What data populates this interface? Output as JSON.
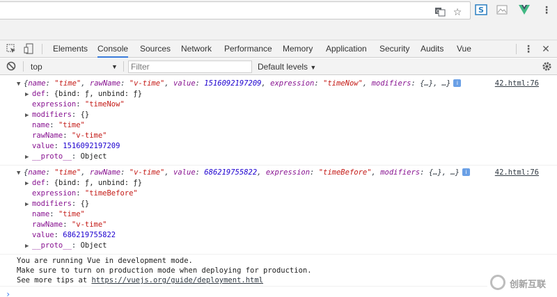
{
  "devtools": {
    "tabs": [
      "Elements",
      "Console",
      "Sources",
      "Network",
      "Performance",
      "Memory",
      "Application",
      "Security",
      "Audits",
      "Vue"
    ],
    "active_tab": "Console"
  },
  "console_toolbar": {
    "context": "top",
    "filter_placeholder": "Filter",
    "levels_label": "Default levels"
  },
  "messages": [
    {
      "summary": {
        "name": "\"time\"",
        "rawName": "\"v-time\"",
        "value": "1516092197209",
        "expression": "\"timeNow\""
      },
      "source": "42.html:76",
      "props": {
        "def": "{bind: ƒ, unbind: ƒ}",
        "expression": "\"timeNow\"",
        "modifiers": "{}",
        "name": "\"time\"",
        "rawName": "\"v-time\"",
        "value": "1516092197209",
        "proto": "Object"
      }
    },
    {
      "summary": {
        "name": "\"time\"",
        "rawName": "\"v-time\"",
        "value": "686219755822",
        "expression": "\"timeBefore\""
      },
      "source": "42.html:76",
      "props": {
        "def": "{bind: ƒ, unbind: ƒ}",
        "expression": "\"timeBefore\"",
        "modifiers": "{}",
        "name": "\"time\"",
        "rawName": "\"v-time\"",
        "value": "686219755822",
        "proto": "Object"
      }
    }
  ],
  "vue_notice": {
    "line1": "You are running Vue in development mode.",
    "line2": "Make sure to turn on production mode when deploying for production.",
    "line3_prefix": "See more tips at ",
    "line3_link": "https://vuejs.org/guide/deployment.html"
  },
  "watermark": "创新互联",
  "colors": {
    "active_tab_underline": "#3879d9",
    "key": "#881391",
    "string": "#c41a16",
    "number": "#1c00cf",
    "prompt": "#367cf1"
  }
}
